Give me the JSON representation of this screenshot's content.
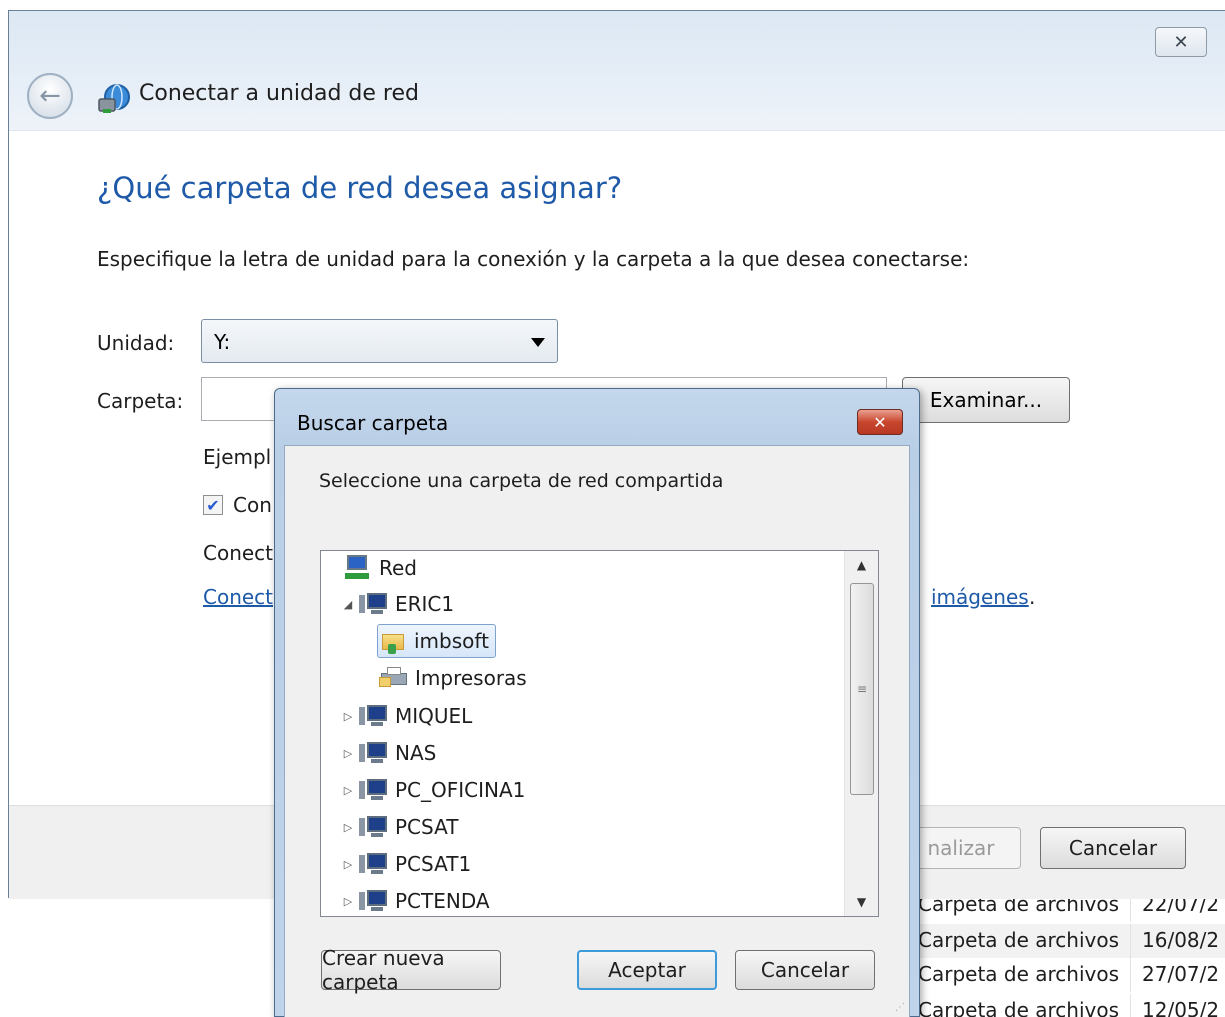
{
  "background": {
    "rows": [
      {
        "type": "Carpeta de archivos",
        "date": "22/07/2",
        "selected": false
      },
      {
        "type": "Carpeta de archivos",
        "date": "16/08/2",
        "selected": true
      },
      {
        "type": "Carpeta de archivos",
        "date": "27/07/2",
        "selected": false
      },
      {
        "type": "Carpeta de archivos",
        "date": "12/05/2",
        "selected": false
      }
    ]
  },
  "wizard": {
    "title": "Conectar a unidad de red",
    "heading": "¿Qué carpeta de red desea asignar?",
    "description": "Especifique la letra de unidad para la conexión y la carpeta a la que desea conectarse:",
    "drive_label": "Unidad:",
    "drive_value": "Y:",
    "folder_label": "Carpeta:",
    "folder_value": "",
    "browse_button": "Examinar...",
    "example_text": "Ejempl",
    "reconnect_text": "Con",
    "reconnect_checked": true,
    "connect_text": "Conect",
    "link_left": "Conect",
    "link_right": "imágenes",
    "link_suffix": ".",
    "finish_button": "nalizar",
    "cancel_button": "Cancelar",
    "close_glyph": "✕"
  },
  "dialog": {
    "title": "Buscar carpeta",
    "prompt": "Seleccione una carpeta de red compartida",
    "tree": [
      {
        "label": "Red",
        "icon": "network-icon",
        "level": 0,
        "expander": "",
        "selected": false
      },
      {
        "label": "ERIC1",
        "icon": "computer-icon",
        "level": 1,
        "expander": "◢",
        "selected": false
      },
      {
        "label": "imbsoft",
        "icon": "shared-folder-icon",
        "level": 2,
        "expander": "",
        "selected": true
      },
      {
        "label": "Impresoras",
        "icon": "printer-icon",
        "level": 2,
        "expander": "",
        "selected": false
      },
      {
        "label": "MIQUEL",
        "icon": "computer-icon",
        "level": 1,
        "expander": "▷",
        "selected": false
      },
      {
        "label": "NAS",
        "icon": "computer-icon",
        "level": 1,
        "expander": "▷",
        "selected": false
      },
      {
        "label": "PC_OFICINA1",
        "icon": "computer-icon",
        "level": 1,
        "expander": "▷",
        "selected": false
      },
      {
        "label": "PCSAT",
        "icon": "computer-icon",
        "level": 1,
        "expander": "▷",
        "selected": false
      },
      {
        "label": "PCSAT1",
        "icon": "computer-icon",
        "level": 1,
        "expander": "▷",
        "selected": false
      },
      {
        "label": "PCTENDA",
        "icon": "computer-icon",
        "level": 1,
        "expander": "▷",
        "selected": false
      }
    ],
    "new_folder_button": "Crear nueva carpeta",
    "ok_button": "Aceptar",
    "cancel_button": "Cancelar",
    "close_glyph": "✕"
  }
}
